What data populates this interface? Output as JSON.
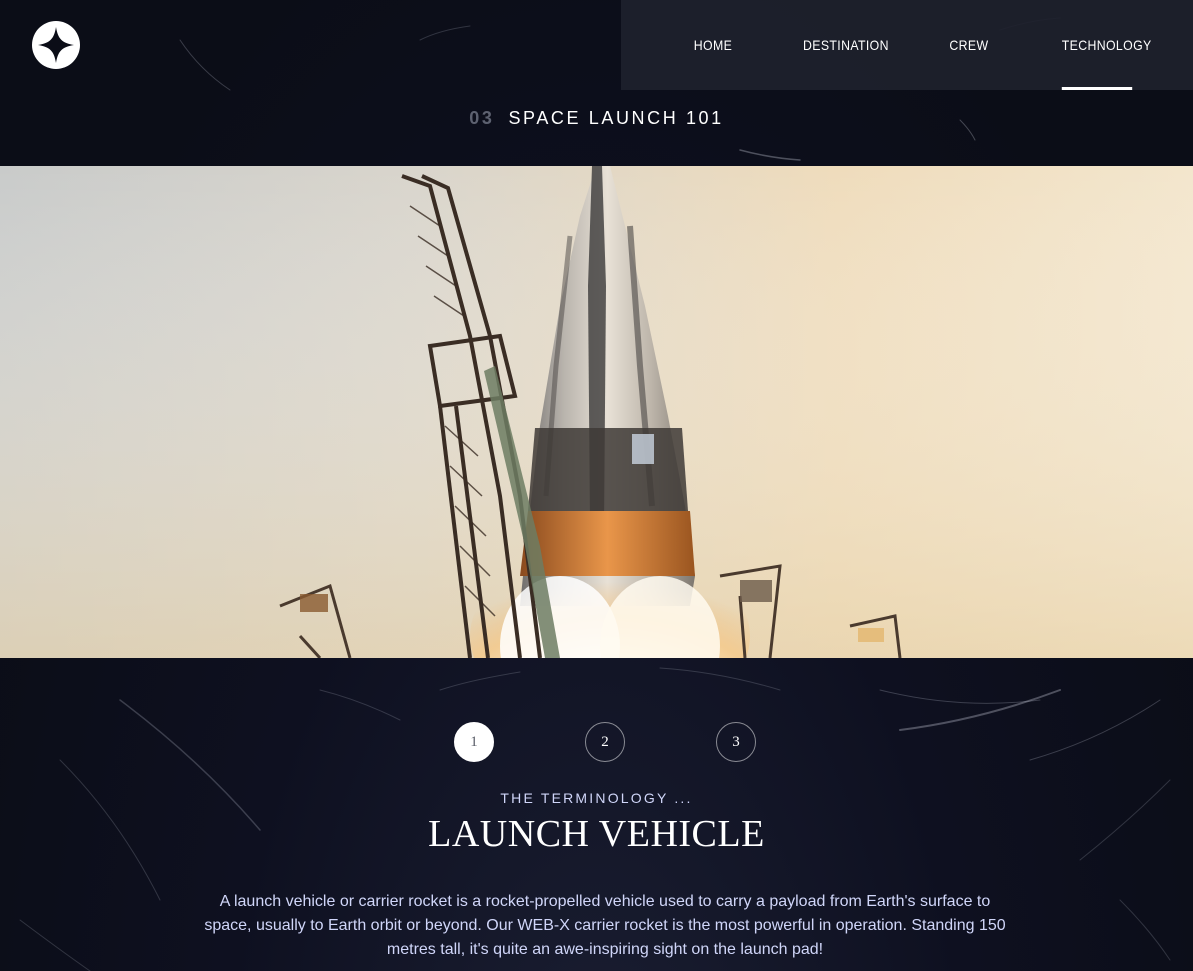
{
  "logo": {
    "icon": "star-logo-icon"
  },
  "nav": {
    "items": [
      {
        "label": "HOME"
      },
      {
        "label": "DESTINATION"
      },
      {
        "label": "CREW"
      },
      {
        "label": "TECHNOLOGY",
        "active": true
      }
    ]
  },
  "section": {
    "number": "03",
    "title": "SPACE LAUNCH 101"
  },
  "pager": {
    "buttons": [
      "1",
      "2",
      "3"
    ],
    "active": "1"
  },
  "content": {
    "eyebrow": "THE TERMINOLOGY ...",
    "title": "LAUNCH VEHICLE",
    "description": "A launch vehicle or carrier rocket is a rocket-propelled vehicle used to carry a payload from Earth's surface to space, usually to Earth orbit or beyond. Our WEB-X carrier rocket is the most powerful in operation. Standing 150 metres tall, it's quite an awe-inspiring sight on the launch pad!"
  },
  "colors": {
    "background": "#0b0d17",
    "nav_background": "#1e212c",
    "accent_text": "#d0d6f9"
  }
}
